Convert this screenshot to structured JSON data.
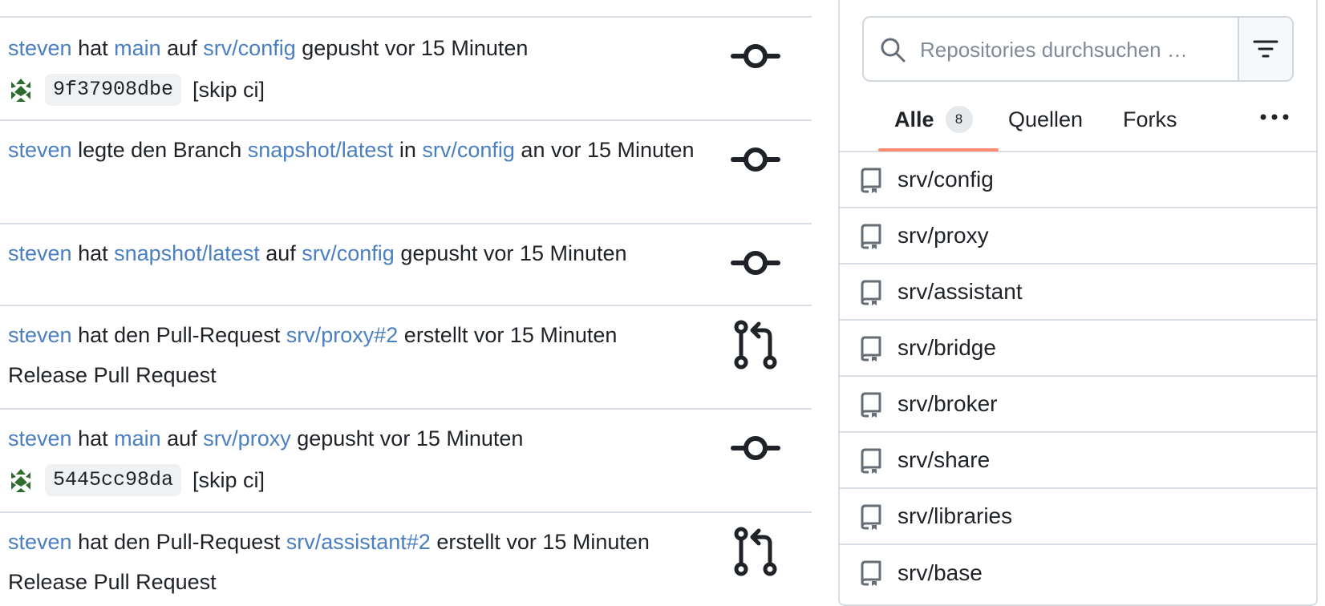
{
  "feed": {
    "items": [
      {
        "actor": "steven",
        "parts": [
          {
            "t": " hat "
          },
          {
            "t": "main",
            "link": true
          },
          {
            "t": " auf "
          },
          {
            "t": "srv/config",
            "link": true
          },
          {
            "t": " gepusht vor 15 Minuten"
          }
        ],
        "icon": "commit-icon",
        "commit": {
          "sha": "9f37908dbe",
          "message": "[skip ci]"
        }
      },
      {
        "actor": "steven",
        "parts": [
          {
            "t": " legte den Branch "
          },
          {
            "t": "snapshot/latest",
            "link": true
          },
          {
            "t": " in "
          },
          {
            "t": "srv/config",
            "link": true
          },
          {
            "t": " an vor 15 Minuten"
          }
        ],
        "icon": "commit-icon"
      },
      {
        "actor": "steven",
        "parts": [
          {
            "t": " hat "
          },
          {
            "t": "snapshot/latest",
            "link": true
          },
          {
            "t": " auf "
          },
          {
            "t": "srv/config",
            "link": true
          },
          {
            "t": " gepusht vor 15 Minuten"
          }
        ],
        "icon": "commit-icon"
      },
      {
        "actor": "steven",
        "parts": [
          {
            "t": " hat den Pull-Request "
          },
          {
            "t": "srv/proxy#2",
            "link": true
          },
          {
            "t": " erstellt vor 15 Minuten"
          }
        ],
        "icon": "pull-request-icon",
        "detail": "Release Pull Request"
      },
      {
        "actor": "steven",
        "parts": [
          {
            "t": " hat "
          },
          {
            "t": "main",
            "link": true
          },
          {
            "t": " auf "
          },
          {
            "t": "srv/proxy",
            "link": true
          },
          {
            "t": " gepusht vor 15 Minuten"
          }
        ],
        "icon": "commit-icon",
        "commit": {
          "sha": "5445cc98da",
          "message": "[skip ci]"
        }
      },
      {
        "actor": "steven",
        "parts": [
          {
            "t": " hat den Pull-Request "
          },
          {
            "t": "srv/assistant#2",
            "link": true
          },
          {
            "t": " erstellt vor 15 Minuten"
          }
        ],
        "icon": "pull-request-icon",
        "detail": "Release Pull Request"
      }
    ]
  },
  "sidebar": {
    "search_placeholder": "Repositories durchsuchen …",
    "tabs": [
      {
        "label": "Alle",
        "count": "8",
        "active": true
      },
      {
        "label": "Quellen"
      },
      {
        "label": "Forks"
      }
    ],
    "repos": [
      "srv/config",
      "srv/proxy",
      "srv/assistant",
      "srv/bridge",
      "srv/broker",
      "srv/share",
      "srv/libraries",
      "srv/base"
    ]
  },
  "colors": {
    "link": "#4a7fc1",
    "border": "#d8dee4",
    "tab_active_underline": "#fd8c73",
    "sha_bg": "#eff1f3"
  }
}
